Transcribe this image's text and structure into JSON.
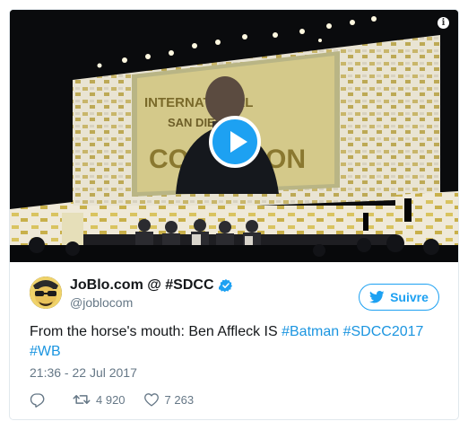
{
  "video": {
    "banner_line_1": "INTERNATIONAL",
    "banner_line_2": "SAN DIEGO",
    "banner_line_3": "COMIC CON"
  },
  "author": {
    "display_name": "JoBlo.com @ #SDCC",
    "handle": "@joblocom"
  },
  "follow_button": {
    "label": "Suivre"
  },
  "tweet": {
    "text_plain": "From the horse's mouth: Ben Affleck IS ",
    "hashtags": [
      "#Batman",
      "#SDCC2017",
      "#WB"
    ],
    "timestamp": "21:36 - 22 Jul 2017"
  },
  "actions": {
    "retweet_count": "4 920",
    "like_count": "7 263"
  },
  "colors": {
    "twitter_blue": "#1da1f2",
    "link_blue": "#1b95e0",
    "muted_gray": "#657786"
  },
  "icons": [
    "info-icon",
    "play-icon",
    "verified-icon",
    "twitter-bird-icon",
    "reply-icon",
    "retweet-icon",
    "like-icon"
  ]
}
